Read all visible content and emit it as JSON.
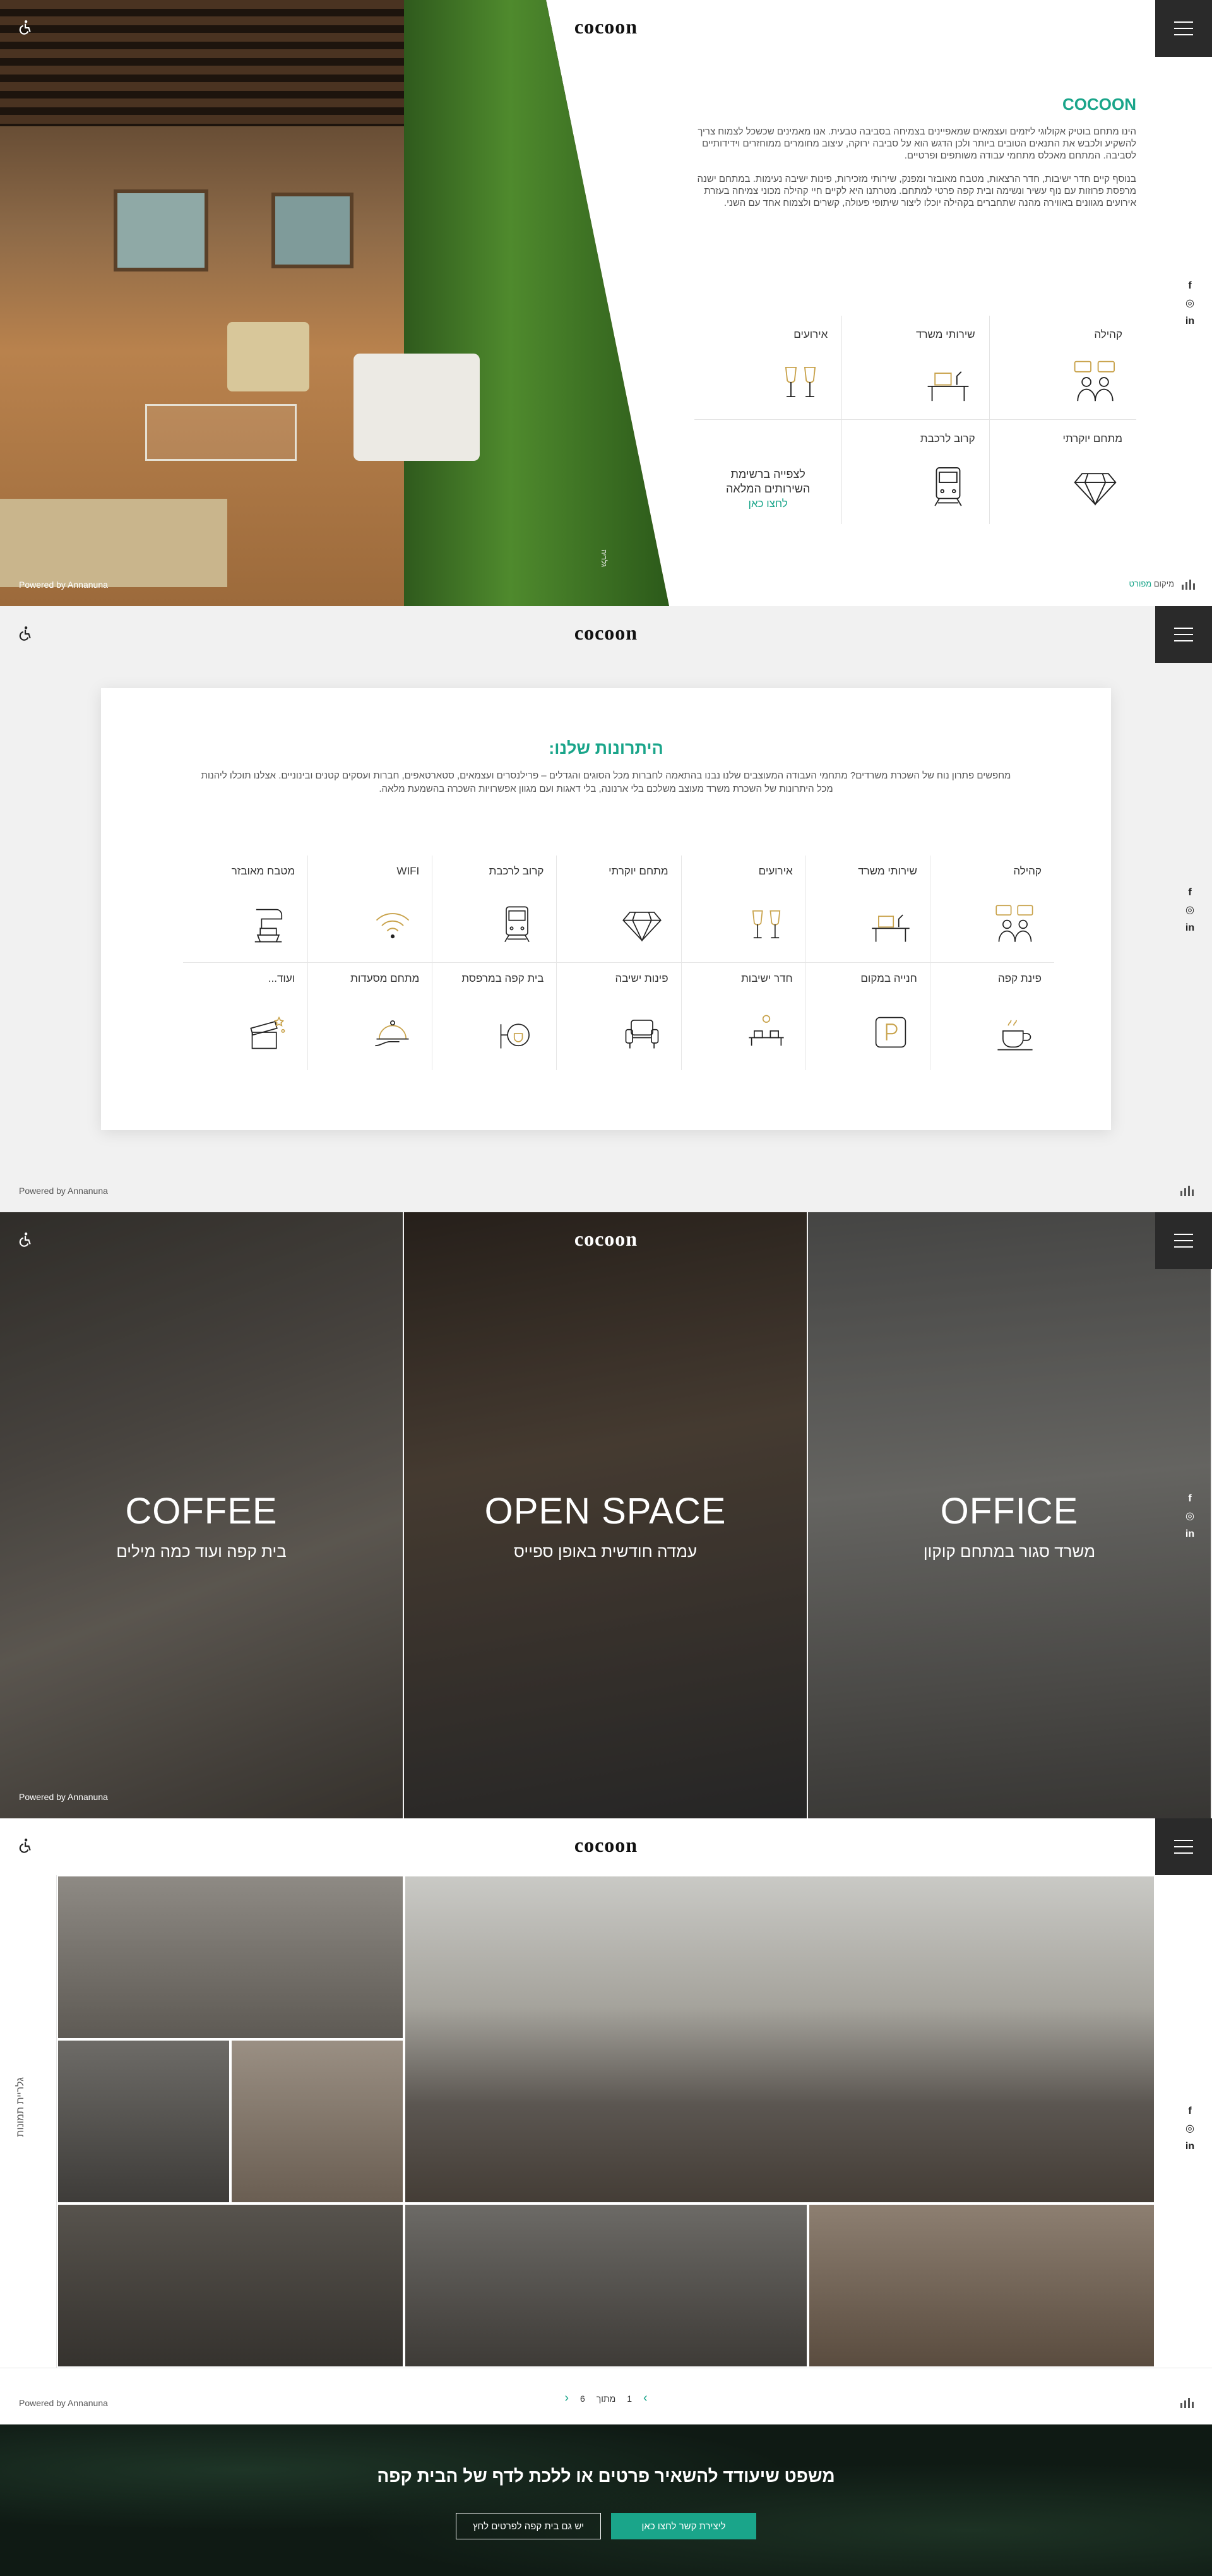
{
  "brand": {
    "logo": "cocoon",
    "accent": "#1aa58a"
  },
  "hero": {
    "title": "COCOON",
    "paragraph1": "הינו מתחם בוטיק אקולוגי ליזמים ועצמאים שמאפיינים בצמיחה בסביבה טבעית. אנו מאמינים שכשכל לצמוח צריך להשקיע ולכבש את התנאים הטובים ביותר ולכן הדגש הוא על סביבה ירוקה, עיצוב מחומרים ממוחזרים וידידותיים לסביבה. המתחם מאכלס מתחמי עבודה משותפים ופרטיים.",
    "paragraph2": "בנוסף קיים חדר ישיבות, חדר הרצאות, מטבח מאובזר ומפנק, שירותי מזכירות, פינות ישיבה נעימות. במתחם ישנה מרפסת פרוזות עם נוף עשיר ונשימה ובית קפה פרטי למתחם. מטרתנו היא לקיים חיי קהילה מכוני צמיחה בעזרת אירועים מגוונים באווירה מהנה שתחברים בקהילה יוכלו ליצור שיתופי פעולה, קשרים ולצמוח אחד עם השני.",
    "features": [
      {
        "label": "קהילה",
        "icon": "community-icon"
      },
      {
        "label": "שירותי משרד",
        "icon": "desk-icon"
      },
      {
        "label": "אירועים",
        "icon": "cheers-icon"
      },
      {
        "label": "מתחם יוקרתי",
        "icon": "diamond-icon"
      },
      {
        "label": "קרוב לרכבת",
        "icon": "train-icon"
      }
    ],
    "cta_text": "לצפייה ברשימת השירותים המלאה",
    "cta_link": "לחצו כאן",
    "photo_label": "גלריה",
    "map_prefix": "מיקום",
    "map_link": "מפורט",
    "powered": "Powered by Annanuna"
  },
  "advantages": {
    "title": "היתרונות שלנו:",
    "subtitle": "מחפשים פתרון נוח של השכרת משרדים? מתחמי העבודה המעוצבים שלנו נבנו בהתאמה לחברות מכל הסוגים והגדלים – פרילנסרים ועצמאים, סטארטאפים, חברות ועסקים קטנים ובינוניים. אצלנו תוכלו ליהנות מכל היתרונות של השכרת משרד מעוצב משלכם בלי ארנונה, בלי דאגות ועם מגוון אפשרויות השכרה בהשמעת מלאה.",
    "items": [
      {
        "label": "קהילה",
        "icon": "community-icon"
      },
      {
        "label": "שירותי משרד",
        "icon": "desk-icon"
      },
      {
        "label": "אירועים",
        "icon": "cheers-icon"
      },
      {
        "label": "מתחם יוקרתי",
        "icon": "diamond-icon"
      },
      {
        "label": "קרוב לרכבת",
        "icon": "train-icon"
      },
      {
        "label": "WIFI",
        "icon": "wifi-icon"
      },
      {
        "label": "מטבח מאובזר",
        "icon": "mixer-icon"
      },
      {
        "label": "פינת קפה",
        "icon": "coffee-icon"
      },
      {
        "label": "חנייה במקום",
        "icon": "parking-icon"
      },
      {
        "label": "חדר ישיבות",
        "icon": "meeting-icon"
      },
      {
        "label": "פינות ישיבה",
        "icon": "armchair-icon"
      },
      {
        "label": "בית קפה במרפסת",
        "icon": "cafe-icon"
      },
      {
        "label": "מתחם מסעדות",
        "icon": "restaurant-icon"
      },
      {
        "label": "ועוד...",
        "icon": "gift-icon"
      }
    ],
    "powered": "Powered by Annanuna"
  },
  "spaces": {
    "panels": [
      {
        "title": "COFFEE",
        "subtitle": "בית קפה ועוד כמה מילים"
      },
      {
        "title": "OPEN SPACE",
        "subtitle": "עמדה חודשית באופן ספייס"
      },
      {
        "title": "OFFICE",
        "subtitle": "משרד סגור במתחם קוקון"
      }
    ],
    "powered": "Powered by Annanuna"
  },
  "gallery": {
    "side_label": "גלריית תמונות",
    "pager": {
      "current": "1",
      "of_word": "מתוך",
      "total": "6"
    },
    "powered": "Powered by Annanuna"
  },
  "footer": {
    "title": "משפט שיעודד להשאיר פרטים או ללכת לדף של הבית קפה",
    "btn_primary": "ליצירת קשר לחצו כאן",
    "btn_secondary": "יש גם בית קפה לפרטים לחץ"
  },
  "social": {
    "facebook": "f",
    "instagram": "◎",
    "linkedin": "in"
  }
}
